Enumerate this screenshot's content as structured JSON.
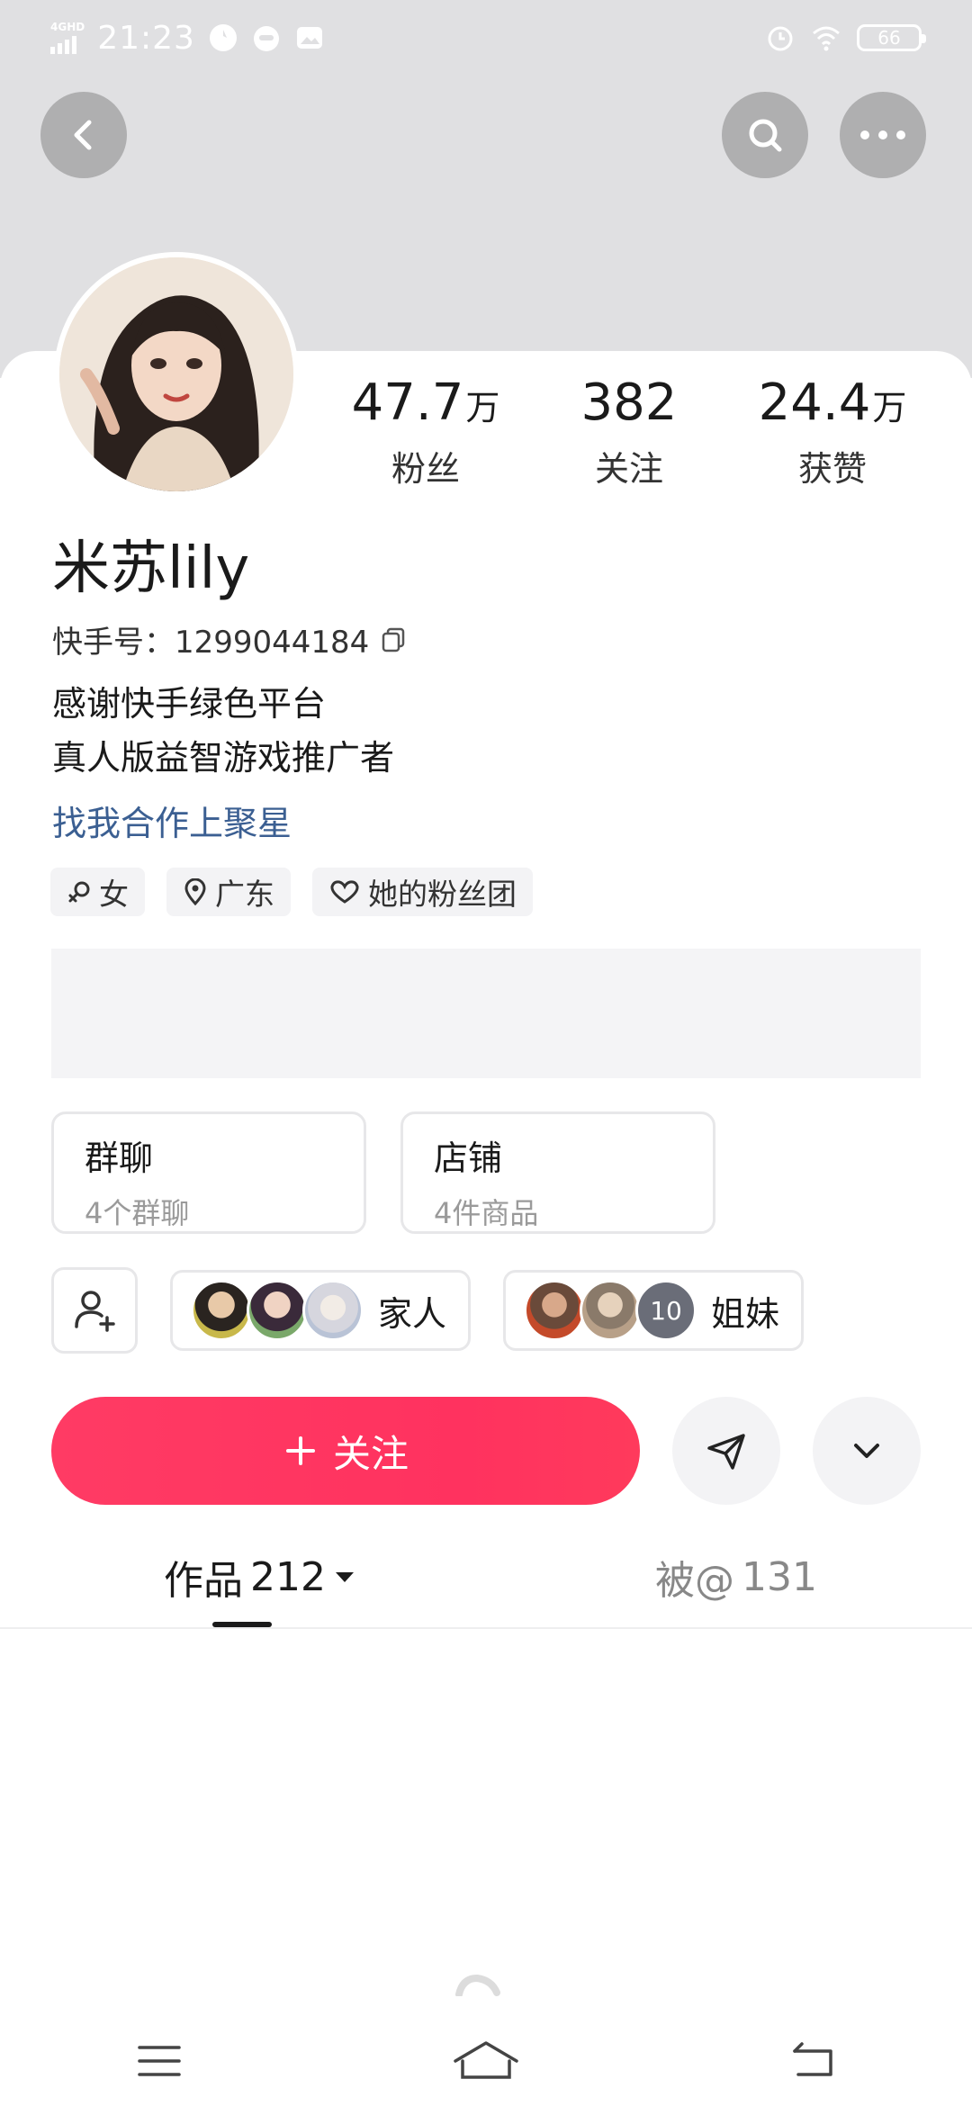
{
  "status_bar": {
    "network": "4GHD",
    "time": "21:23",
    "battery": "66"
  },
  "profile": {
    "name": "米苏lily",
    "kwai_id_label": "快手号：",
    "kwai_id": "1299044184",
    "bio_lines": [
      "感谢快手绿色平台",
      "真人版益智游戏推广者"
    ],
    "cooperate_link": "找我合作上聚星",
    "tags": {
      "gender": "女",
      "location": "广东",
      "fan_club": "她的粉丝团"
    }
  },
  "stats": {
    "fans": {
      "value": "47.7",
      "unit": "万",
      "label": "粉丝"
    },
    "following": {
      "value": "382",
      "unit": "",
      "label": "关注"
    },
    "likes": {
      "value": "24.4",
      "unit": "万",
      "label": "获赞"
    }
  },
  "cards": {
    "group_chat": {
      "title": "群聊",
      "subtitle": "4个群聊"
    },
    "store": {
      "title": "店铺",
      "subtitle": "4件商品"
    }
  },
  "friends": {
    "family_label": "家人",
    "sisters_label": "姐妹",
    "sisters_extra_count": "10"
  },
  "actions": {
    "follow_label": "关注"
  },
  "tabs": {
    "works_label": "作品",
    "works_count": "212",
    "mentions_label": "被@",
    "mentions_count": "131"
  },
  "colors": {
    "accent": "#ff3261",
    "link": "#3b5f92",
    "header_bg": "#e0e0e2"
  }
}
